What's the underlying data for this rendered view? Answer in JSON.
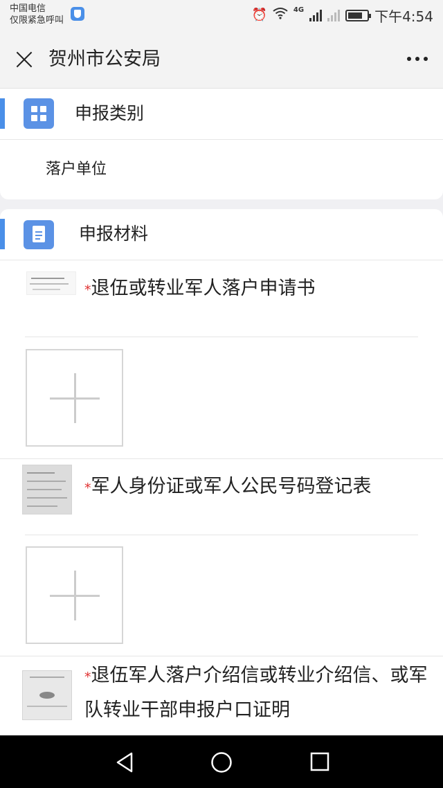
{
  "status_bar": {
    "carrier": "中国电信",
    "carrier_note": "仅限紧急呼叫",
    "network": "4G",
    "time": "下午4:54",
    "icons": [
      "shield-icon",
      "alarm-icon",
      "wifi-icon",
      "signal-icon",
      "battery-icon"
    ]
  },
  "nav": {
    "title": "贺州市公安局",
    "close_icon": "close-icon",
    "more_icon": "more-icon"
  },
  "category": {
    "title": "申报类别",
    "icon": "grid-icon",
    "value": "落户单位"
  },
  "materials": {
    "title": "申报材料",
    "icon": "document-icon",
    "items": [
      {
        "required_mark": "*",
        "label": "退伍或转业军人落户申请书"
      },
      {
        "required_mark": "*",
        "label": "军人身份证或军人公民号码登记表"
      },
      {
        "required_mark": "*",
        "label": "退伍军人落户介绍信或转业介绍信、或军队转业干部申报户口证明"
      }
    ]
  },
  "colors": {
    "accent": "#4a8fe8",
    "required": "#e03030",
    "page_background": "#f0f0f3"
  }
}
